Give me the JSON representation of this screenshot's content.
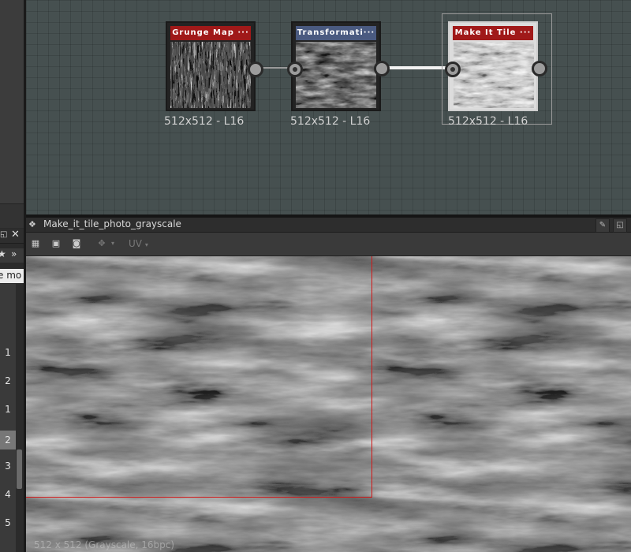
{
  "graph": {
    "nodes": [
      {
        "title": "Grunge Map ···",
        "title_color": "#a01919",
        "size_label": "512x512 - L16"
      },
      {
        "title": "Transformati···",
        "title_color": "#4a5a80",
        "size_label": "512x512 - L16"
      },
      {
        "title": "Make It Tile ···",
        "title_color": "#a01919",
        "size_label": "512x512 - L16"
      }
    ]
  },
  "view2d": {
    "title": "Make_it_tile_photo_grayscale",
    "uv_label": "UV",
    "uv_arrow": "▾",
    "status": "512 x 512 (Grayscale, 16bpc)",
    "tile_frame_color": "#d01818"
  },
  "left_panel": {
    "star": "★",
    "chevron": "»",
    "label_fragment": "e mo",
    "row_numbers": [
      "1",
      "2",
      "1",
      "2",
      "3",
      "4",
      "5"
    ]
  },
  "icons": {
    "pin": "pin-icon",
    "float": "float-window-icon"
  }
}
